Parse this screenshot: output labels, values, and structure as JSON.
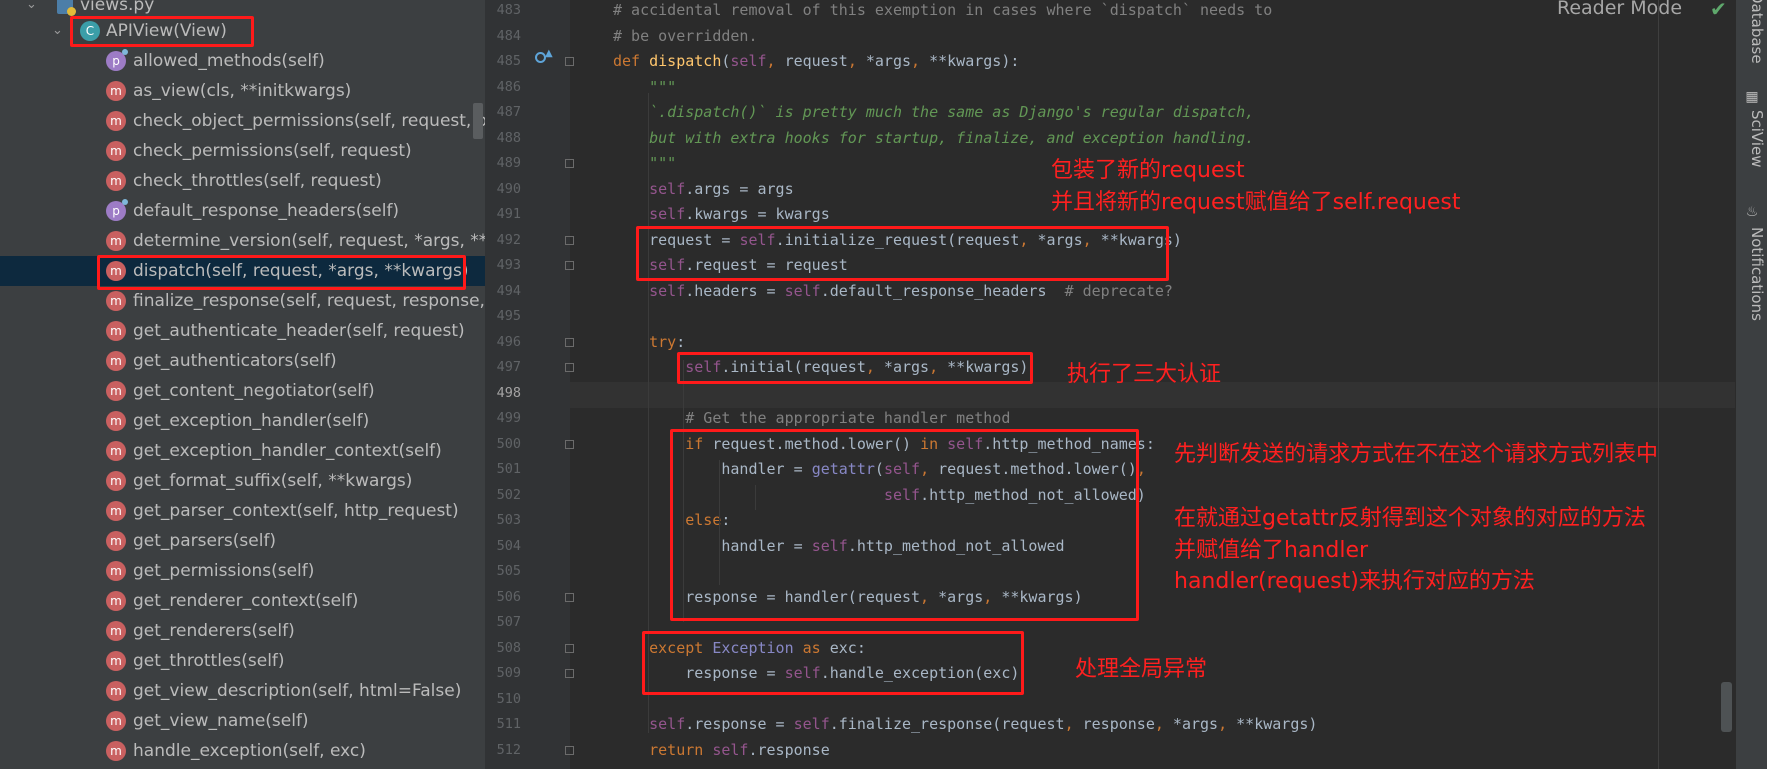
{
  "structure": {
    "file": "views.py",
    "class_item": "APIView(View)",
    "members": [
      {
        "kind": "p",
        "label": "allowed_methods(self)"
      },
      {
        "kind": "m",
        "label": "as_view(cls, **initkwargs)"
      },
      {
        "kind": "m",
        "label": "check_object_permissions(self, request, o"
      },
      {
        "kind": "m",
        "label": "check_permissions(self, request)"
      },
      {
        "kind": "m",
        "label": "check_throttles(self, request)"
      },
      {
        "kind": "p",
        "label": "default_response_headers(self)"
      },
      {
        "kind": "m",
        "label": "determine_version(self, request, *args, **k"
      },
      {
        "kind": "m",
        "label": "dispatch(self, request, *args, **kwargs)"
      },
      {
        "kind": "m",
        "label": "finalize_response(self, request, response,"
      },
      {
        "kind": "m",
        "label": "get_authenticate_header(self, request)"
      },
      {
        "kind": "m",
        "label": "get_authenticators(self)"
      },
      {
        "kind": "m",
        "label": "get_content_negotiator(self)"
      },
      {
        "kind": "m",
        "label": "get_exception_handler(self)"
      },
      {
        "kind": "m",
        "label": "get_exception_handler_context(self)"
      },
      {
        "kind": "m",
        "label": "get_format_suffix(self, **kwargs)"
      },
      {
        "kind": "m",
        "label": "get_parser_context(self, http_request)"
      },
      {
        "kind": "m",
        "label": "get_parsers(self)"
      },
      {
        "kind": "m",
        "label": "get_permissions(self)"
      },
      {
        "kind": "m",
        "label": "get_renderer_context(self)"
      },
      {
        "kind": "m",
        "label": "get_renderers(self)"
      },
      {
        "kind": "m",
        "label": "get_throttles(self)"
      },
      {
        "kind": "m",
        "label": "get_view_description(self, html=False)"
      },
      {
        "kind": "m",
        "label": "get_view_name(self)"
      },
      {
        "kind": "m",
        "label": "handle_exception(self, exc)"
      }
    ],
    "badge_letters": {
      "m": "m",
      "p": "p",
      "c": "C"
    }
  },
  "editor": {
    "reader_mode_label": "Reader Mode",
    "line_numbers": [
      "483",
      "484",
      "485",
      "486",
      "487",
      "488",
      "489",
      "490",
      "491",
      "492",
      "493",
      "494",
      "495",
      "496",
      "497",
      "498",
      "499",
      "500",
      "501",
      "502",
      "503",
      "504",
      "505",
      "506",
      "507",
      "508",
      "509",
      "510",
      "511",
      "512"
    ],
    "code_lines": [
      "# accidental removal of this exemption in cases where `dispatch` needs to",
      "# be overridden.",
      "def dispatch(self, request, *args, **kwargs):",
      "    \"\"\"",
      "    `.dispatch()` is pretty much the same as Django's regular dispatch,",
      "    but with extra hooks for startup, finalize, and exception handling.",
      "    \"\"\"",
      "    self.args = args",
      "    self.kwargs = kwargs",
      "    request = self.initialize_request(request, *args, **kwargs)",
      "    self.request = request",
      "    self.headers = self.default_response_headers  # deprecate?",
      "",
      "    try:",
      "        self.initial(request, *args, **kwargs)",
      "",
      "        # Get the appropriate handler method",
      "        if request.method.lower() in self.http_method_names:",
      "            handler = getattr(self, request.method.lower(),",
      "                              self.http_method_not_allowed)",
      "        else:",
      "            handler = self.http_method_not_allowed",
      "",
      "        response = handler(request, *args, **kwargs)",
      "",
      "    except Exception as exc:",
      "        response = self.handle_exception(exc)",
      "",
      "    self.response = self.finalize_response(request, response, *args, **kwargs)",
      "    return self.response"
    ]
  },
  "annotations": {
    "note1_line1": "包装了新的request",
    "note1_line2": "并且将新的request赋值给了self.request",
    "note2": "执行了三大认证",
    "note3": "先判断发送的请求方式在不在这个请求方式列表中",
    "note4_line1": "在就通过getattr反射得到这个对象的对应的方法",
    "note4_line2": "并赋值给了handler",
    "note4_line3": "handler(request)来执行对应的方法",
    "note5": "处理全局异常"
  },
  "toolstrip": {
    "database": "Database",
    "sciview": "SciView",
    "notifications": "Notifications"
  },
  "colors": {
    "annotation_red": "#ff1a1a",
    "selection": "#0d293e",
    "keyword": "#cc7832",
    "function": "#ffc66d",
    "self": "#94558d",
    "comment": "#808080",
    "docstring": "#629755"
  }
}
